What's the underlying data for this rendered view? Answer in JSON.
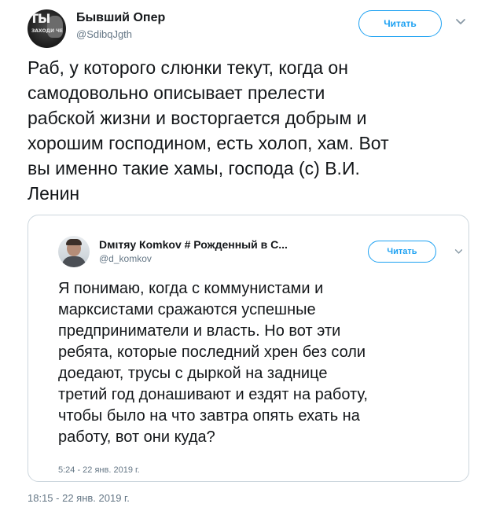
{
  "tweet": {
    "author_name": "Бывший Опер",
    "author_handle": "@SdibqJgth",
    "avatar_text": "ТЫ",
    "avatar_subtext": "ЗАХОДИ ЧЕ",
    "follow_label": "Читать",
    "text_lines": [
      "Раб, у которого слюнки текут, когда он",
      "самодовольно описывает прелести",
      "рабской жизни и восторгается добрым и",
      "хорошим господином, есть холоп, хам. Вот",
      "вы именно такие хамы, господа (с) В.И.",
      "Ленин"
    ],
    "timestamp": "18:15 - 22 янв. 2019 г."
  },
  "quote": {
    "author_name": "Dмιтяу Кomkov # Рожденный в С...",
    "author_handle": "@d_komkov",
    "follow_label": "Читать",
    "text_lines": [
      "Я понимаю, когда с коммунистами и",
      "марксистами сражаются успешные",
      "предприниматели и власть. Но вот эти",
      "ребята, которые последний хрен без соли",
      "доедают, трусы с дыркой на заднице",
      "третий год донашивают и ездят на работу,",
      "чтобы было на что завтра опять ехать на",
      "работу, вот они куда?"
    ],
    "timestamp": "5:24 - 22 янв. 2019 г."
  },
  "icons": {
    "more_menu": "chevron-down-icon"
  },
  "colors": {
    "accent": "#1da1f2",
    "text": "#14171a",
    "secondary": "#657786",
    "border": "#ccd6dd"
  }
}
